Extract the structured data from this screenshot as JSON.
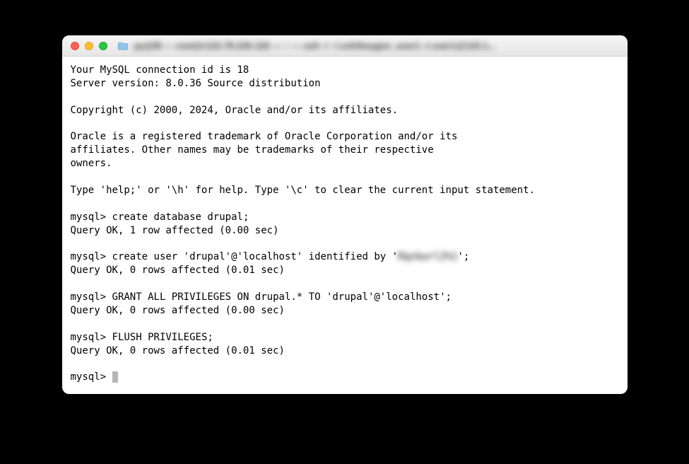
{
  "window": {
    "title_blurred": "py@M — root@r123.78.230.126 — ~ — ssh -i ~/.ssh/keygen_user1 -t user1@123.1..."
  },
  "terminal": {
    "lines": {
      "l1": "Your MySQL connection id is 18",
      "l2": "Server version: 8.0.36 Source distribution",
      "l3": "Copyright (c) 2000, 2024, Oracle and/or its affiliates.",
      "l4": "Oracle is a registered trademark of Oracle Corporation and/or its",
      "l5": "affiliates. Other names may be trademarks of their respective",
      "l6": "owners.",
      "l7": "Type 'help;' or '\\h' for help. Type '\\c' to clear the current input statement.",
      "prompt": "mysql> ",
      "cmd1": "create database drupal;",
      "res1": "Query OK, 1 row affected (0.00 sec)",
      "cmd2_pre": "create user 'drupal'@'localhost' identified by '",
      "cmd2_secret": "Rqxkwrl2%1",
      "cmd2_post": "';",
      "res2": "Query OK, 0 rows affected (0.01 sec)",
      "cmd3": "GRANT ALL PRIVILEGES ON drupal.* TO 'drupal'@'localhost';",
      "res3": "Query OK, 0 rows affected (0.00 sec)",
      "cmd4": "FLUSH PRIVILEGES;",
      "res4": "Query OK, 0 rows affected (0.01 sec)"
    }
  }
}
